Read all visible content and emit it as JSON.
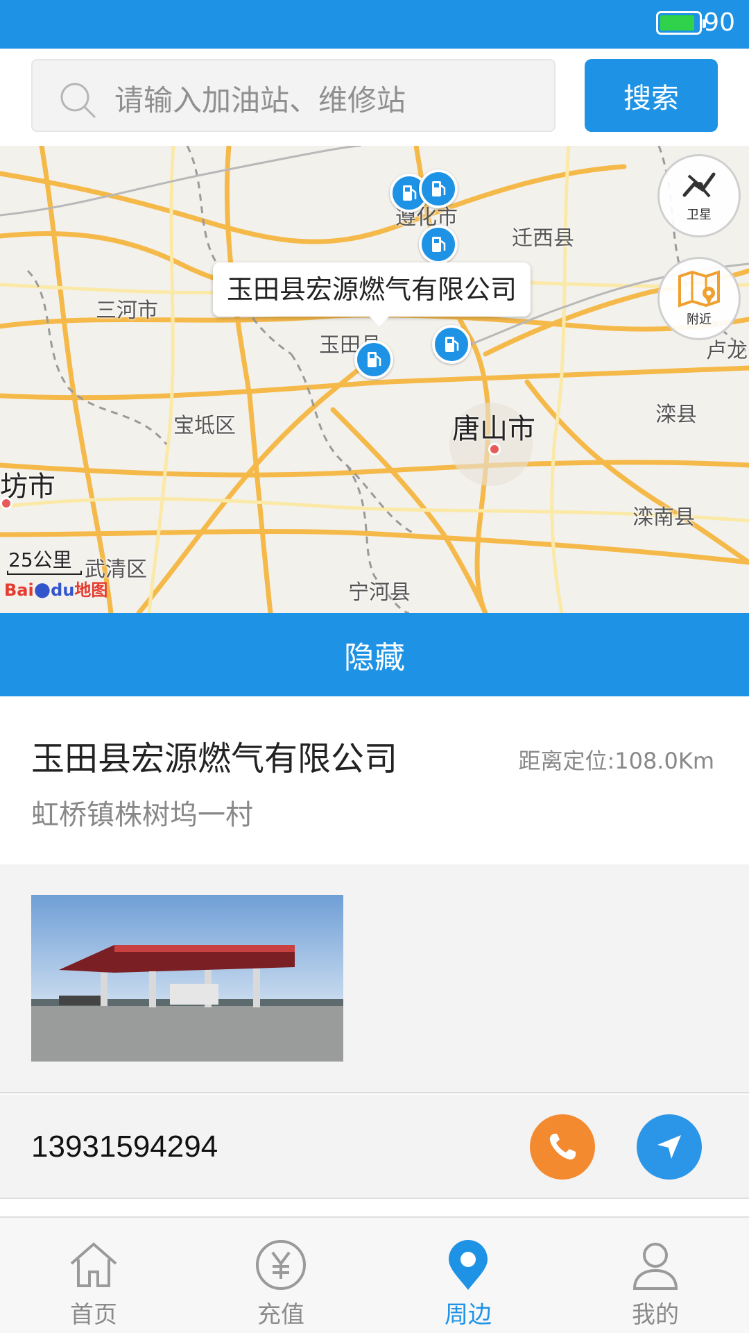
{
  "status_bar": {
    "battery_level": "90",
    "battery_fraction": 0.9,
    "background": "#1e93e6"
  },
  "search": {
    "placeholder": "请输入加油站、维修站",
    "button_label": "搜索"
  },
  "map": {
    "popup": "玉田县宏源燃气有限公司",
    "labels": {
      "zunhua": "遵化市",
      "qianxi": "迁西县",
      "sanhe": "三河市",
      "yutian": "玉田县",
      "lulong": "卢龙",
      "baodi": "宝坻区",
      "tangshan": "唐山市",
      "luanxian": "滦县",
      "langfang": "坊市",
      "luannan": "滦南县",
      "wuqing": "武清区",
      "ninghe": "宁河县"
    },
    "scale": "25公里",
    "logo": {
      "part1": "Bai",
      "part2": "du",
      "part3": "地图"
    },
    "controls": {
      "satellite": "卫星",
      "nearby": "附近"
    }
  },
  "hide_button": "隐藏",
  "station": {
    "name": "玉田县宏源燃气有限公司",
    "distance": "距离定位:108.0Km",
    "address": "虹桥镇株树坞一村",
    "phone": "13931594294"
  },
  "tabs": [
    {
      "label": "首页",
      "icon": "home-icon"
    },
    {
      "label": "充值",
      "icon": "yuan-icon"
    },
    {
      "label": "周边",
      "icon": "location-pin-icon",
      "active": true
    },
    {
      "label": "我的",
      "icon": "user-icon"
    }
  ],
  "colors": {
    "primary": "#1e93e6",
    "call": "#f48a30",
    "navigate": "#2b96e8"
  }
}
